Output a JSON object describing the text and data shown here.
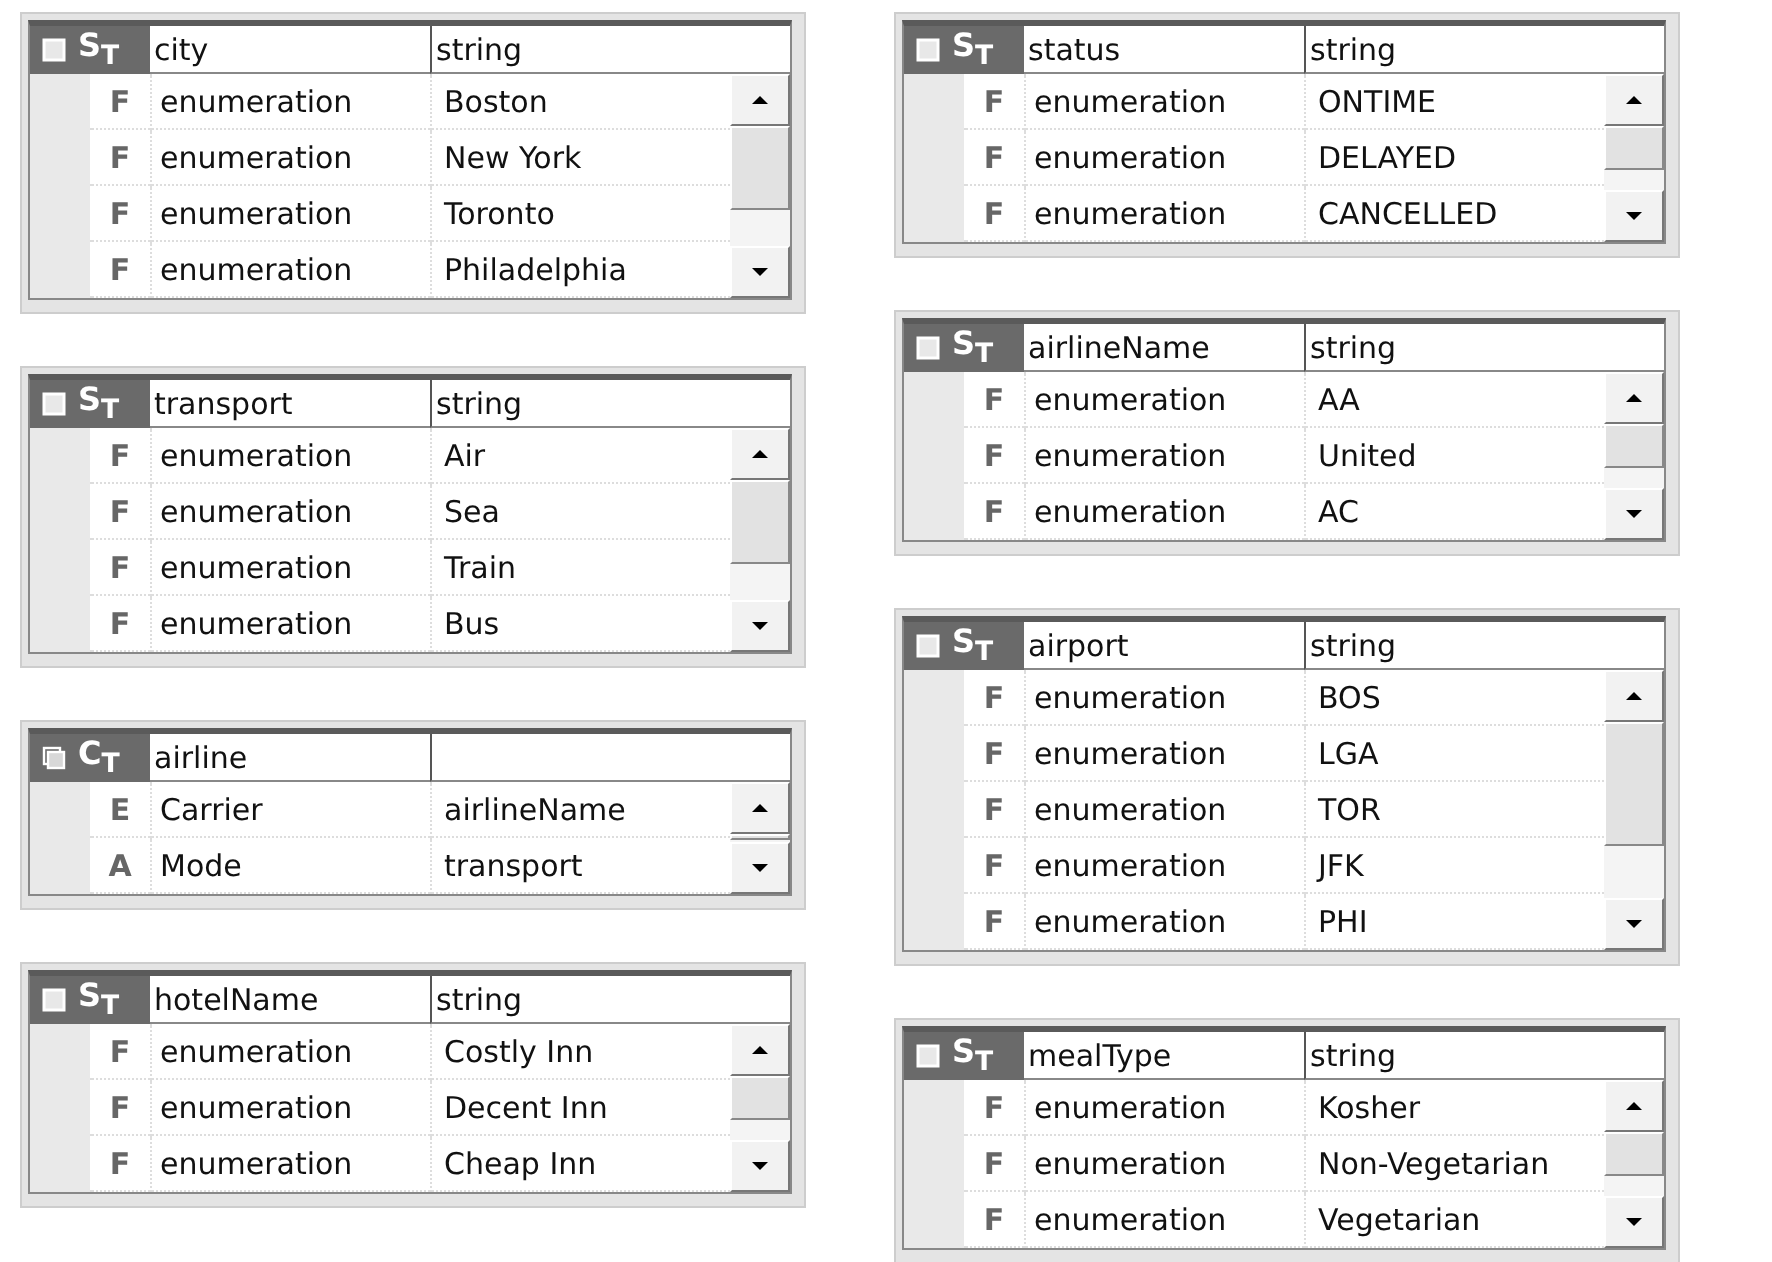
{
  "columns": [
    {
      "tables": [
        {
          "kind": "simple",
          "kind_label": "S$_{T}$",
          "name": "city",
          "type": "string",
          "rows": [
            {
              "marker": "F",
              "name": "enumeration",
              "value": "Boston"
            },
            {
              "marker": "F",
              "name": "enumeration",
              "value": "New York"
            },
            {
              "marker": "F",
              "name": "enumeration",
              "value": "Toronto"
            },
            {
              "marker": "F",
              "name": "enumeration",
              "value": "Philadelphia"
            }
          ]
        },
        {
          "kind": "simple",
          "kind_label": "S$_{T}$",
          "name": "transport",
          "type": "string",
          "rows": [
            {
              "marker": "F",
              "name": "enumeration",
              "value": "Air"
            },
            {
              "marker": "F",
              "name": "enumeration",
              "value": "Sea"
            },
            {
              "marker": "F",
              "name": "enumeration",
              "value": "Train"
            },
            {
              "marker": "F",
              "name": "enumeration",
              "value": "Bus"
            }
          ]
        },
        {
          "kind": "complex",
          "kind_label": "C$_{T}$",
          "name": "airline",
          "rows": [
            {
              "marker": "E",
              "name": "Carrier",
              "value": "airlineName"
            },
            {
              "marker": "A",
              "name": "Mode",
              "value": "transport"
            }
          ]
        },
        {
          "kind": "simple",
          "kind_label": "S$_{T}$",
          "name": "hotelName",
          "type": "string",
          "rows": [
            {
              "marker": "F",
              "name": "enumeration",
              "value": "Costly Inn"
            },
            {
              "marker": "F",
              "name": "enumeration",
              "value": "Decent Inn"
            },
            {
              "marker": "F",
              "name": "enumeration",
              "value": "Cheap Inn"
            }
          ]
        }
      ]
    },
    {
      "tables": [
        {
          "kind": "simple",
          "kind_label": "S$_{T}$",
          "name": "status",
          "type": "string",
          "rows": [
            {
              "marker": "F",
              "name": "enumeration",
              "value": "ONTIME"
            },
            {
              "marker": "F",
              "name": "enumeration",
              "value": "DELAYED"
            },
            {
              "marker": "F",
              "name": "enumeration",
              "value": "CANCELLED"
            }
          ]
        },
        {
          "kind": "simple",
          "kind_label": "S$_{T}$",
          "name": "airlineName",
          "type": "string",
          "rows": [
            {
              "marker": "F",
              "name": "enumeration",
              "value": "AA"
            },
            {
              "marker": "F",
              "name": "enumeration",
              "value": "United"
            },
            {
              "marker": "F",
              "name": "enumeration",
              "value": "AC"
            }
          ]
        },
        {
          "kind": "simple",
          "kind_label": "S$_{T}$",
          "name": "airport",
          "type": "string",
          "rows": [
            {
              "marker": "F",
              "name": "enumeration",
              "value": "BOS"
            },
            {
              "marker": "F",
              "name": "enumeration",
              "value": "LGA"
            },
            {
              "marker": "F",
              "name": "enumeration",
              "value": "TOR"
            },
            {
              "marker": "F",
              "name": "enumeration",
              "value": "JFK"
            },
            {
              "marker": "F",
              "name": "enumeration",
              "value": "PHI"
            }
          ]
        },
        {
          "kind": "simple",
          "kind_label": "S$_{T}$",
          "name": "mealType",
          "type": "string",
          "rows": [
            {
              "marker": "F",
              "name": "enumeration",
              "value": "Kosher"
            },
            {
              "marker": "F",
              "name": "enumeration",
              "value": "Non-Vegetarian"
            },
            {
              "marker": "F",
              "name": "enumeration",
              "value": "Vegetarian"
            }
          ]
        }
      ]
    }
  ]
}
